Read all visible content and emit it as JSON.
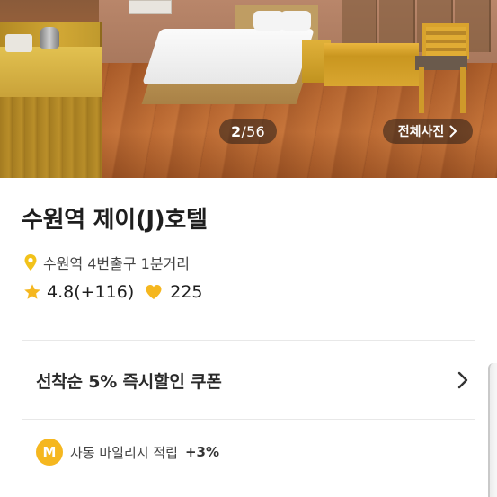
{
  "gallery": {
    "counter_current": "2",
    "counter_total": "/56",
    "all_photos_label": "전체사진"
  },
  "hotel": {
    "name": "수원역 제이(J)호텔",
    "location": "수원역 4번출구 1분거리",
    "rating": "4.8(+116)",
    "likes": "225"
  },
  "coupon": {
    "label": "선착순 5% 즉시할인 쿠폰"
  },
  "mileage": {
    "badge": "M",
    "label": "자동 마일리지 적립",
    "rate": "+3%"
  },
  "colors": {
    "accent_yellow": "#f5b71f",
    "pin_yellow": "#f2c21a",
    "text_dark": "#1e1e1e",
    "divider": "#e8e8e8"
  },
  "icons": {
    "location": "location-pin-icon",
    "rating": "star-icon",
    "likes": "heart-icon",
    "coupon_arrow": "chevron-right-icon",
    "photos_arrow": "chevron-right-icon"
  }
}
